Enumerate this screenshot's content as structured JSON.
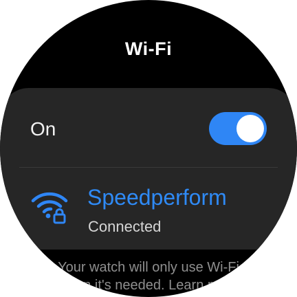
{
  "screen": {
    "title": "Wi-Fi"
  },
  "toggle": {
    "label": "On",
    "state": "on"
  },
  "network": {
    "name": "Speedperform",
    "status": "Connected",
    "icon": "wifi-lock-icon"
  },
  "footer": {
    "line1": "Your watch will only use Wi-Fi",
    "line2": "when it's needed. Learn more"
  },
  "colors": {
    "accent": "#2f86f5",
    "background": "#000000",
    "card": "#262626"
  }
}
